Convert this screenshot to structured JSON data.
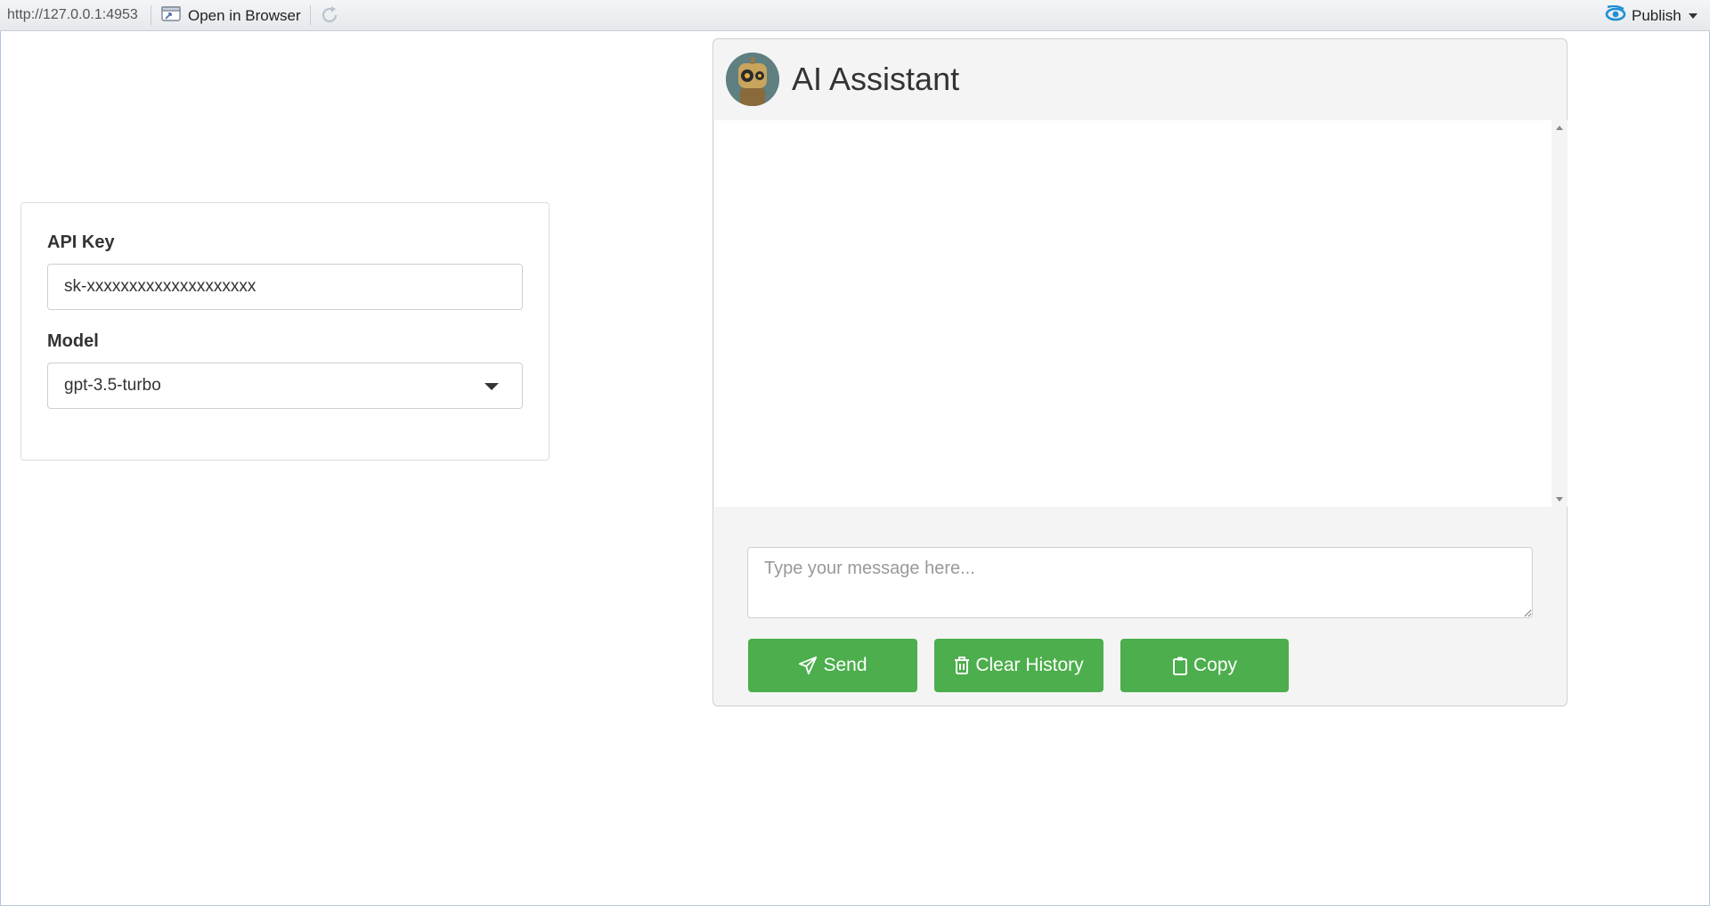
{
  "toolbar": {
    "url": "http://127.0.0.1:4953",
    "open_in_browser": "Open in Browser",
    "publish": "Publish"
  },
  "settings": {
    "api_key_label": "API Key",
    "api_key_value": "sk-xxxxxxxxxxxxxxxxxxxx",
    "model_label": "Model",
    "model_value": "gpt-3.5-turbo"
  },
  "chat": {
    "title": "AI Assistant",
    "input_placeholder": "Type your message here...",
    "send_label": "Send",
    "clear_label": "Clear History",
    "copy_label": "Copy"
  },
  "colors": {
    "button_green": "#4cae4c",
    "panel_bg": "#f4f4f4",
    "publish_icon_blue": "#1f8fd6"
  },
  "icons": [
    "open-in-browser-icon",
    "refresh-icon",
    "publish-icon",
    "robot-avatar",
    "paper-plane-icon",
    "trash-icon",
    "clipboard-icon"
  ]
}
